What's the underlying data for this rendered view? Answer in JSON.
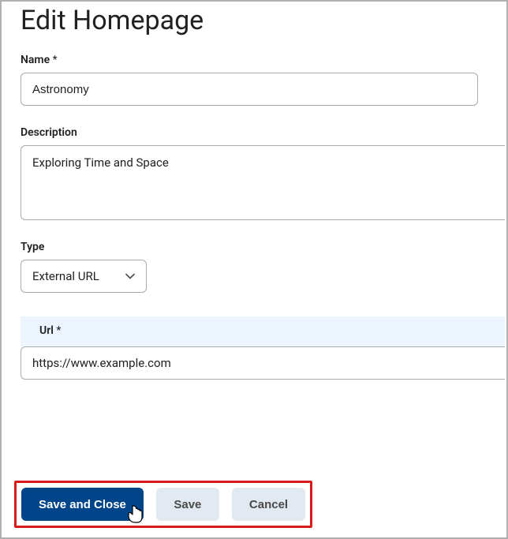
{
  "page": {
    "title": "Edit Homepage"
  },
  "fields": {
    "name": {
      "label": "Name",
      "required_mark": "*",
      "value": "Astronomy"
    },
    "description": {
      "label": "Description",
      "value": "Exploring Time and Space"
    },
    "type": {
      "label": "Type",
      "selected": "External URL"
    },
    "url": {
      "label": "Url",
      "required_mark": "*",
      "value": "https://www.example.com"
    }
  },
  "buttons": {
    "save_close": "Save and Close",
    "save": "Save",
    "cancel": "Cancel"
  }
}
